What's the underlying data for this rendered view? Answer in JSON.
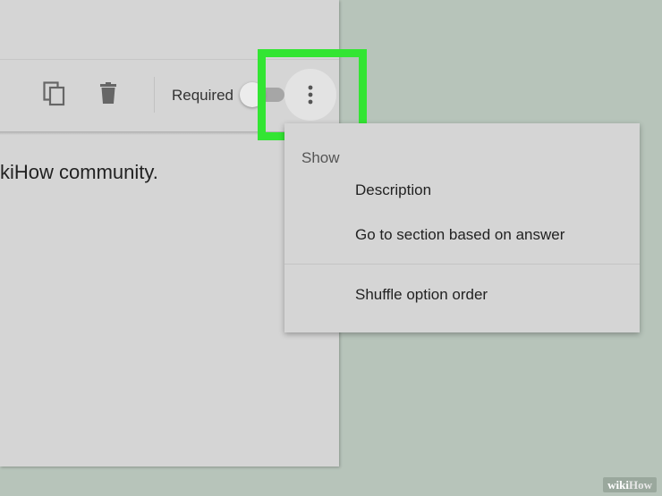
{
  "toolbar": {
    "copy_icon": "duplicate-icon",
    "delete_icon": "trash-icon",
    "required_label": "Required",
    "required_on": false,
    "more_icon": "more-vert-icon"
  },
  "question": {
    "text_fragment": "kiHow community."
  },
  "menu": {
    "heading": "Show",
    "items": [
      {
        "label": "Description"
      },
      {
        "label": "Go to section based on answer"
      },
      {
        "label": "Shuffle option order"
      }
    ]
  },
  "highlight_color": "#33e533",
  "watermark": {
    "part1": "wiki",
    "part2": "How"
  }
}
